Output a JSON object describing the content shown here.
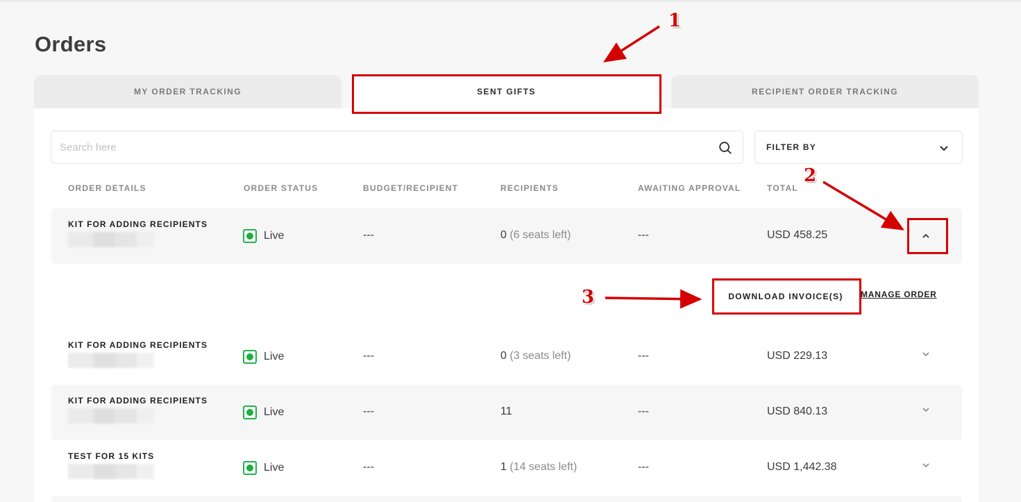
{
  "page": {
    "title": "Orders"
  },
  "tabs": [
    {
      "label": "MY ORDER TRACKING",
      "active": false
    },
    {
      "label": "SENT GIFTS",
      "active": true
    },
    {
      "label": "RECIPIENT ORDER TRACKING",
      "active": false
    }
  ],
  "search": {
    "placeholder": "Search here",
    "value": "",
    "icon": "search-icon"
  },
  "filter": {
    "label": "FILTER BY",
    "icon": "chevron-down-icon"
  },
  "columns": [
    "ORDER DETAILS",
    "ORDER STATUS",
    "BUDGET/RECIPIENT",
    "RECIPIENTS",
    "AWAITING APPROVAL",
    "TOTAL"
  ],
  "orders": [
    {
      "name": "KIT FOR ADDING RECIPIENTS",
      "status": "Live",
      "budget": "---",
      "recipients": "0",
      "seats": "(6 seats left)",
      "awaiting": "---",
      "total": "USD 458.25",
      "expanded": true
    },
    {
      "name": "KIT FOR ADDING RECIPIENTS",
      "status": "Live",
      "budget": "---",
      "recipients": "0",
      "seats": "(3 seats left)",
      "awaiting": "---",
      "total": "USD 229.13",
      "expanded": false
    },
    {
      "name": "KIT FOR ADDING RECIPIENTS",
      "status": "Live",
      "budget": "---",
      "recipients": "11",
      "seats": "",
      "awaiting": "---",
      "total": "USD 840.13",
      "expanded": false
    },
    {
      "name": "TEST FOR 15 KITS",
      "status": "Live",
      "budget": "---",
      "recipients": "1",
      "seats": "(14 seats left)",
      "awaiting": "---",
      "total": "USD 1,442.38",
      "expanded": false
    }
  ],
  "order_actions": {
    "download": "DOWNLOAD INVOICE(S)",
    "manage": "MANAGE ORDER"
  },
  "annotations": {
    "one": "1",
    "two": "2",
    "three": "3",
    "color": "#d40000"
  },
  "colors": {
    "status_live": "#1fae3f",
    "background": "#f7f7f7",
    "tab_inactive": "#ececec"
  }
}
